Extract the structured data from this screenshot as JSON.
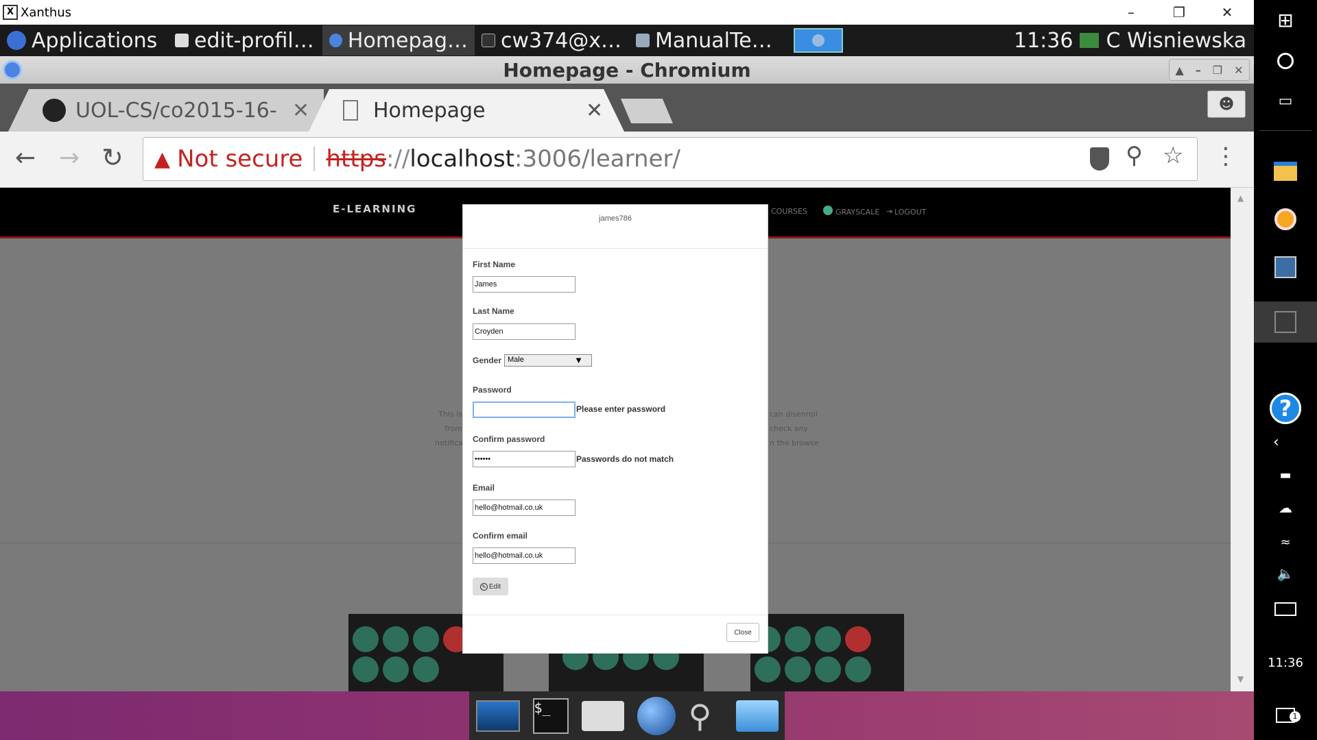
{
  "xanthus": {
    "title": "Xanthus",
    "icon_letter": "X"
  },
  "panel": {
    "applications": "Applications",
    "tasks": [
      {
        "label": "edit-profil…"
      },
      {
        "label": "Homepag…"
      },
      {
        "label": "cw374@x…"
      },
      {
        "label": "ManualTe…"
      }
    ],
    "clock": "11:36",
    "user": "C Wisniewska"
  },
  "chromium": {
    "title": "Homepage - Chromium",
    "tabs": [
      {
        "label": "UOL-CS/co2015-16-"
      },
      {
        "label": "Homepage"
      }
    ],
    "not_secure": "Not secure",
    "url_scheme": "https",
    "url_sep": "://",
    "url_host": "localhost",
    "url_rest": ":3006/learner/"
  },
  "site": {
    "brand": "E-LEARNING",
    "nav_courses": "COURSES",
    "nav_grayscale": "GRAYSCALE",
    "nav_logout": "LOGOUT",
    "bg_text_left": [
      "This is",
      "from",
      "notifica"
    ],
    "bg_text_right": [
      "can disenroll",
      "check any",
      "n the browse"
    ]
  },
  "modal": {
    "username": "james786",
    "first_name_label": "First Name",
    "first_name_value": "James",
    "last_name_label": "Last Name",
    "last_name_value": "Croyden",
    "gender_label": "Gender",
    "gender_value": "Male",
    "password_label": "Password",
    "password_value": "",
    "password_error": "Please enter password",
    "confirm_password_label": "Confirm password",
    "confirm_password_value": "••••••",
    "confirm_password_error": "Passwords do not match",
    "email_label": "Email",
    "email_value": "hello@hotmail.co.uk",
    "confirm_email_label": "Confirm email",
    "confirm_email_value": "hello@hotmail.co.uk",
    "edit_button": "Edit",
    "close_button": "Close"
  },
  "winbar": {
    "clock": "11:36",
    "notification_count": "1"
  },
  "colors": {
    "not_secure_red": "#c5221f",
    "nav_underline": "#8a1a1a",
    "dock_purple": "#92356f"
  }
}
